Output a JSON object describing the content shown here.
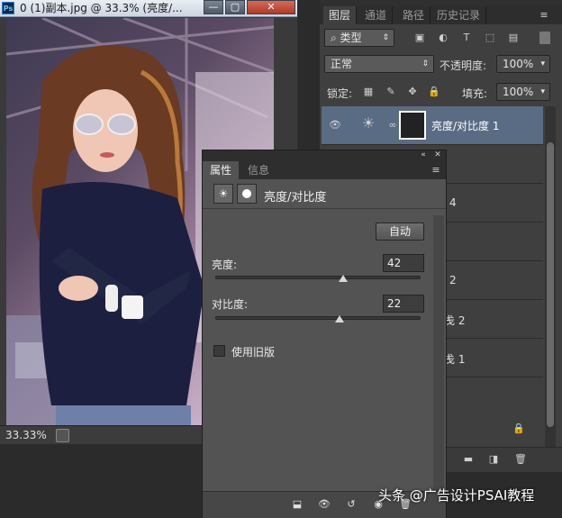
{
  "document": {
    "title": "0 (1)副本.jpg @ 33.3% (亮度/...",
    "ps_logo": "Ps",
    "buttons": {
      "minimize": "—",
      "maximize": "▢",
      "close": "✕"
    },
    "zoom": "33.33%"
  },
  "layers_panel": {
    "tabs": [
      "图层",
      "通道",
      "路径",
      "历史记录"
    ],
    "filter_kind": "类型",
    "blend_mode": "正常",
    "opacity_label": "不透明度:",
    "opacity_value": "100%",
    "lock_label": "锁定:",
    "fill_label": "填充:",
    "fill_value": "100%",
    "selected_layer": "亮度/对比度 1",
    "partial_labels": [
      "4",
      "2",
      "戋 2",
      "戋 1"
    ]
  },
  "properties_panel": {
    "tabs": [
      "属性",
      "信息"
    ],
    "title": "亮度/对比度",
    "auto_label": "自动",
    "brightness": {
      "label": "亮度:",
      "value": "42",
      "fraction": 0.62
    },
    "contrast": {
      "label": "对比度:",
      "value": "22",
      "fraction": 0.6
    },
    "legacy_label": "使用旧版"
  },
  "watermark": "头条 @广告设计PSAI教程",
  "colors": {
    "panel": "#535353",
    "selected_layer": "#5a6b84",
    "background": "#2b2b2b"
  }
}
